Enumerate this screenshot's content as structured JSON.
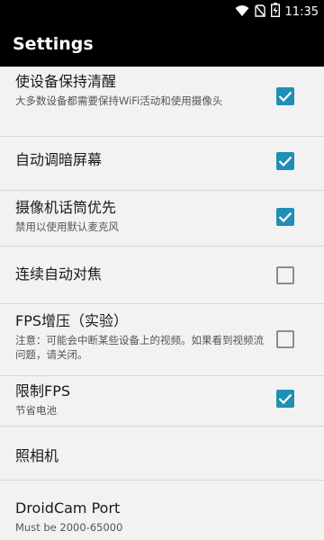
{
  "status_bar": {
    "time": "11:35",
    "icons": [
      "wifi-icon",
      "no-sim-icon",
      "battery-icon"
    ]
  },
  "app_bar": {
    "title": "Settings"
  },
  "settings": [
    {
      "title": "使设备保持清醒",
      "summary": "大多数设备都需要保持WiFi活动和使用摄像头",
      "checked": true
    },
    {
      "title": "自动调暗屏幕",
      "summary": "",
      "checked": true
    },
    {
      "title": "摄像机话筒优先",
      "summary": "禁用以使用默认麦克风",
      "checked": true
    },
    {
      "title": "连续自动对焦",
      "summary": "",
      "checked": false
    },
    {
      "title": "FPS增压（实验）",
      "summary": "注意：可能会中断某些设备上的视频。如果看到视频流问题，请关闭。",
      "checked": false
    },
    {
      "title": "限制FPS",
      "summary": "节省电池",
      "checked": true
    },
    {
      "title": "照相机",
      "summary": ""
    },
    {
      "title": "DroidCam Port",
      "summary": "Must be 2000-65000"
    }
  ],
  "colors": {
    "accent": "#1f8fb4",
    "bar": "#000000",
    "background": "#f2f2f2"
  }
}
